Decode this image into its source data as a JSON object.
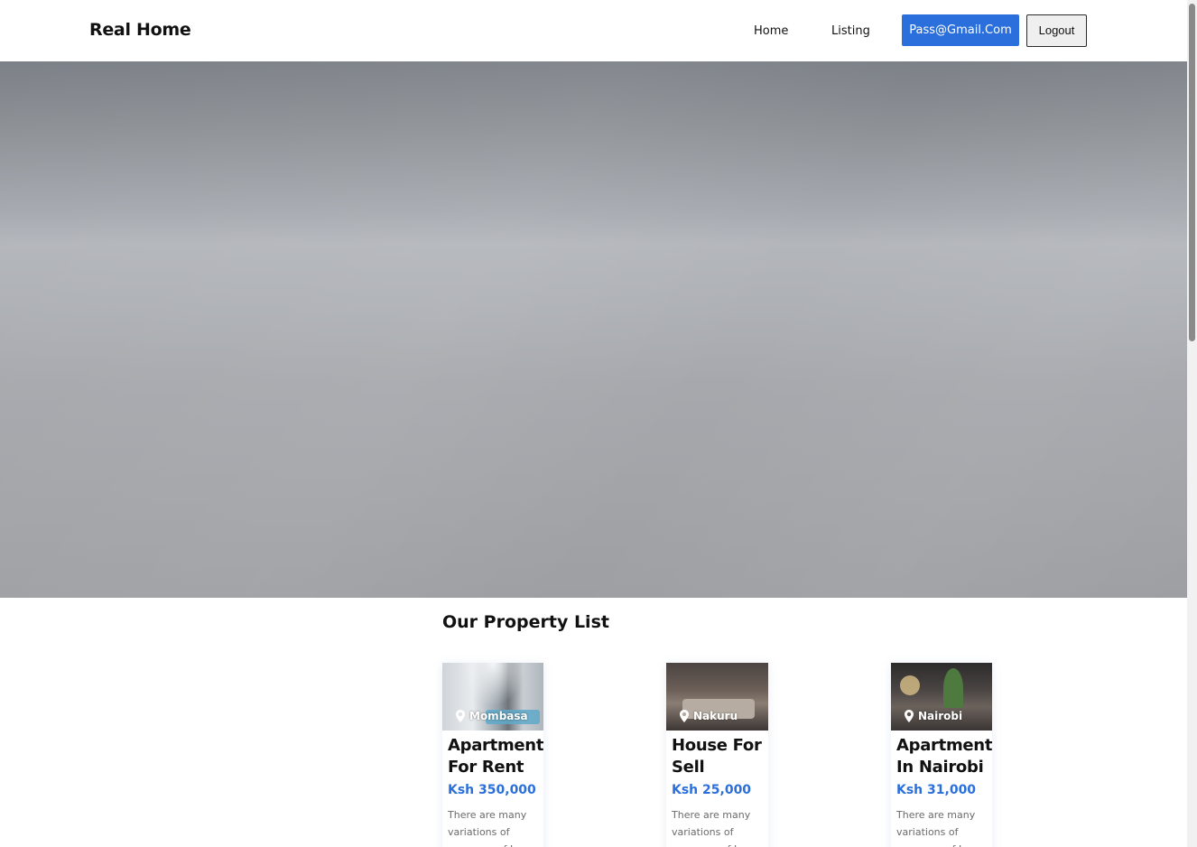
{
  "navbar": {
    "brand": "Real Home",
    "links": [
      {
        "label": "Home"
      },
      {
        "label": "Listing"
      }
    ],
    "user_button_label": "Pass@Gmail.Com",
    "logout_label": "Logout"
  },
  "section": {
    "title": "Our Property List"
  },
  "properties": [
    {
      "location": "Mombasa",
      "title": "Apartment For Rent",
      "price": "Ksh 350,000",
      "description": "There are many variations of passages of Lorem"
    },
    {
      "location": "Nakuru",
      "title": "House For Sell",
      "price": "Ksh 25,000",
      "description": "There are many variations of passages of Lorem"
    },
    {
      "location": "Nairobi",
      "title": "Apartment In Nairobi",
      "price": "Ksh 31,000",
      "description": "There are many variations of passages of Lorem"
    }
  ],
  "colors": {
    "accent": "#2a6fdb",
    "text": "#111111",
    "muted": "#6b6b6b"
  },
  "icons": {
    "location": "map-pin-icon"
  }
}
